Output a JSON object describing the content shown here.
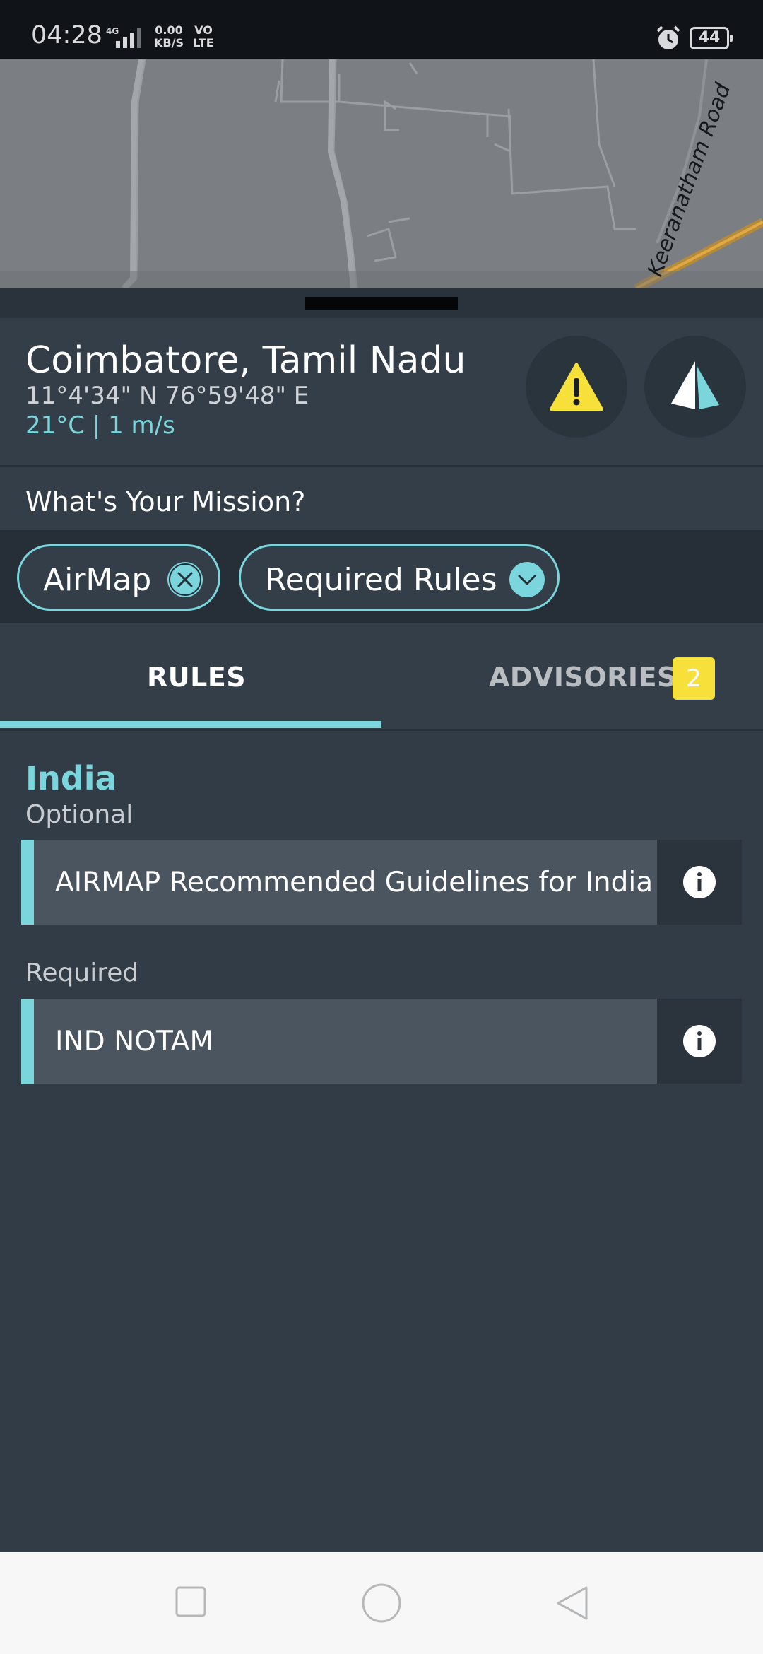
{
  "status_bar": {
    "time": "04:28",
    "network": "4G",
    "speed_value": "0.00",
    "speed_unit": "KB/S",
    "volte_top": "VO",
    "volte_bottom": "LTE",
    "battery": "44"
  },
  "map": {
    "road_label": "Keeranatham Road"
  },
  "location": {
    "title": "Coimbatore, Tamil Nadu",
    "coordinates": "11°4'34\" N  76°59'48\" E",
    "weather": "21°C | 1 m/s"
  },
  "mission": {
    "prompt": "What's Your Mission?"
  },
  "chips": {
    "airmap": "AirMap",
    "rules": "Required Rules"
  },
  "tabs": {
    "rules": "RULES",
    "advisories": "ADVISORIES",
    "advisories_count": "2"
  },
  "rules_section": {
    "country": "India",
    "optional_label": "Optional",
    "required_label": "Required",
    "optional_items": [
      "AIRMAP Recommended Guidelines for India"
    ],
    "required_items": [
      "IND NOTAM"
    ]
  },
  "colors": {
    "accent": "#7ad6dc",
    "warning": "#f7e03a",
    "panel": "#333e48",
    "background": "#323c46"
  },
  "icons": {
    "warning": "warning-triangle-icon",
    "navigation": "navigation-arrow-icon",
    "clear": "close-circle-icon",
    "dropdown": "chevron-down-icon",
    "info": "info-icon"
  }
}
